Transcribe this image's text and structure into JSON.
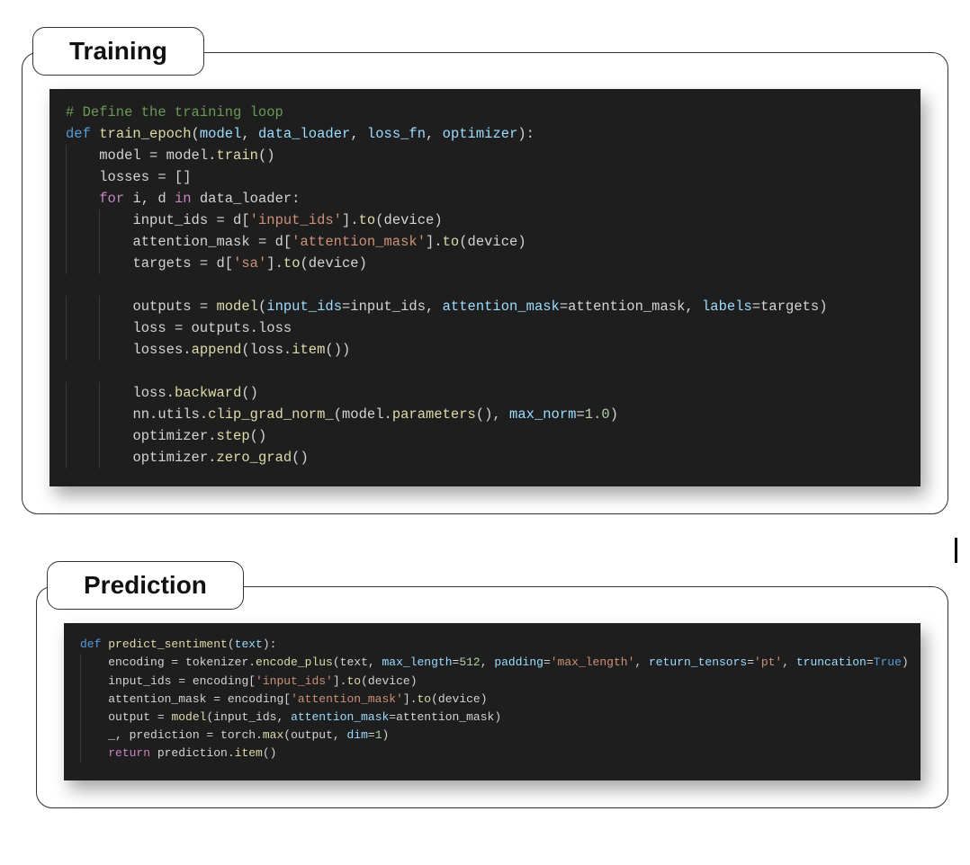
{
  "sections": {
    "training": {
      "title": "Training",
      "code": {
        "tokens": [
          [
            {
              "t": "# Define the training loop",
              "c": "comment"
            }
          ],
          [
            {
              "t": "def ",
              "c": "keyword"
            },
            {
              "t": "train_epoch",
              "c": "func"
            },
            {
              "t": "(",
              "c": "default"
            },
            {
              "t": "model",
              "c": "var"
            },
            {
              "t": ", ",
              "c": "default"
            },
            {
              "t": "data_loader",
              "c": "var"
            },
            {
              "t": ", ",
              "c": "default"
            },
            {
              "t": "loss_fn",
              "c": "var"
            },
            {
              "t": ", ",
              "c": "default"
            },
            {
              "t": "optimizer",
              "c": "var"
            },
            {
              "t": "):",
              "c": "default"
            }
          ],
          [
            {
              "t": "    ",
              "c": "indent1"
            },
            {
              "t": "model = model.",
              "c": "default"
            },
            {
              "t": "train",
              "c": "func"
            },
            {
              "t": "()",
              "c": "default"
            }
          ],
          [
            {
              "t": "    ",
              "c": "indent1"
            },
            {
              "t": "losses = []",
              "c": "default"
            }
          ],
          [
            {
              "t": "    ",
              "c": "indent1"
            },
            {
              "t": "for ",
              "c": "control"
            },
            {
              "t": "i, d ",
              "c": "default"
            },
            {
              "t": "in ",
              "c": "control"
            },
            {
              "t": "data_loader:",
              "c": "default"
            }
          ],
          [
            {
              "t": "        ",
              "c": "indent2"
            },
            {
              "t": "input_ids = d[",
              "c": "default"
            },
            {
              "t": "'input_ids'",
              "c": "string"
            },
            {
              "t": "].",
              "c": "default"
            },
            {
              "t": "to",
              "c": "func"
            },
            {
              "t": "(device)",
              "c": "default"
            }
          ],
          [
            {
              "t": "        ",
              "c": "indent2"
            },
            {
              "t": "attention_mask = d[",
              "c": "default"
            },
            {
              "t": "'attention_mask'",
              "c": "string"
            },
            {
              "t": "].",
              "c": "default"
            },
            {
              "t": "to",
              "c": "func"
            },
            {
              "t": "(device)",
              "c": "default"
            }
          ],
          [
            {
              "t": "        ",
              "c": "indent2"
            },
            {
              "t": "targets = d[",
              "c": "default"
            },
            {
              "t": "'sa'",
              "c": "string"
            },
            {
              "t": "].",
              "c": "default"
            },
            {
              "t": "to",
              "c": "func"
            },
            {
              "t": "(device)",
              "c": "default"
            }
          ],
          [
            {
              "t": "",
              "c": "blank"
            }
          ],
          [
            {
              "t": "        ",
              "c": "indent2"
            },
            {
              "t": "outputs = ",
              "c": "default"
            },
            {
              "t": "model",
              "c": "func"
            },
            {
              "t": "(",
              "c": "default"
            },
            {
              "t": "input_ids",
              "c": "var"
            },
            {
              "t": "=input_ids, ",
              "c": "default"
            },
            {
              "t": "attention_mask",
              "c": "var"
            },
            {
              "t": "=attention_mask, ",
              "c": "default"
            },
            {
              "t": "labels",
              "c": "var"
            },
            {
              "t": "=targets)",
              "c": "default"
            }
          ],
          [
            {
              "t": "        ",
              "c": "indent2"
            },
            {
              "t": "loss = outputs.loss",
              "c": "default"
            }
          ],
          [
            {
              "t": "        ",
              "c": "indent2"
            },
            {
              "t": "losses.",
              "c": "default"
            },
            {
              "t": "append",
              "c": "func"
            },
            {
              "t": "(loss.",
              "c": "default"
            },
            {
              "t": "item",
              "c": "func"
            },
            {
              "t": "())",
              "c": "default"
            }
          ],
          [
            {
              "t": "",
              "c": "blank"
            }
          ],
          [
            {
              "t": "        ",
              "c": "indent2"
            },
            {
              "t": "loss.",
              "c": "default"
            },
            {
              "t": "backward",
              "c": "func"
            },
            {
              "t": "()",
              "c": "default"
            }
          ],
          [
            {
              "t": "        ",
              "c": "indent2"
            },
            {
              "t": "nn.utils.",
              "c": "default"
            },
            {
              "t": "clip_grad_norm_",
              "c": "func"
            },
            {
              "t": "(model.",
              "c": "default"
            },
            {
              "t": "parameters",
              "c": "func"
            },
            {
              "t": "(), ",
              "c": "default"
            },
            {
              "t": "max_norm",
              "c": "var"
            },
            {
              "t": "=",
              "c": "default"
            },
            {
              "t": "1.0",
              "c": "number"
            },
            {
              "t": ")",
              "c": "default"
            }
          ],
          [
            {
              "t": "        ",
              "c": "indent2"
            },
            {
              "t": "optimizer.",
              "c": "default"
            },
            {
              "t": "step",
              "c": "func"
            },
            {
              "t": "()",
              "c": "default"
            }
          ],
          [
            {
              "t": "        ",
              "c": "indent2"
            },
            {
              "t": "optimizer.",
              "c": "default"
            },
            {
              "t": "zero_grad",
              "c": "func"
            },
            {
              "t": "()",
              "c": "default"
            }
          ]
        ]
      }
    },
    "prediction": {
      "title": "Prediction",
      "code": {
        "tokens": [
          [
            {
              "t": "def ",
              "c": "keyword"
            },
            {
              "t": "predict_sentiment",
              "c": "func"
            },
            {
              "t": "(",
              "c": "default"
            },
            {
              "t": "text",
              "c": "var"
            },
            {
              "t": "):",
              "c": "default"
            }
          ],
          [
            {
              "t": "    ",
              "c": "indent1"
            },
            {
              "t": "encoding = tokenizer.",
              "c": "default"
            },
            {
              "t": "encode_plus",
              "c": "func"
            },
            {
              "t": "(text, ",
              "c": "default"
            },
            {
              "t": "max_length",
              "c": "var"
            },
            {
              "t": "=",
              "c": "default"
            },
            {
              "t": "512",
              "c": "number"
            },
            {
              "t": ", ",
              "c": "default"
            },
            {
              "t": "padding",
              "c": "var"
            },
            {
              "t": "=",
              "c": "default"
            },
            {
              "t": "'max_length'",
              "c": "string"
            },
            {
              "t": ", ",
              "c": "default"
            },
            {
              "t": "return_tensors",
              "c": "var"
            },
            {
              "t": "=",
              "c": "default"
            },
            {
              "t": "'pt'",
              "c": "string"
            },
            {
              "t": ", ",
              "c": "default"
            },
            {
              "t": "truncation",
              "c": "var"
            },
            {
              "t": "=",
              "c": "default"
            },
            {
              "t": "True",
              "c": "keyword"
            },
            {
              "t": ")",
              "c": "default"
            }
          ],
          [
            {
              "t": "    ",
              "c": "indent1"
            },
            {
              "t": "input_ids = encoding[",
              "c": "default"
            },
            {
              "t": "'input_ids'",
              "c": "string"
            },
            {
              "t": "].",
              "c": "default"
            },
            {
              "t": "to",
              "c": "func"
            },
            {
              "t": "(device)",
              "c": "default"
            }
          ],
          [
            {
              "t": "    ",
              "c": "indent1"
            },
            {
              "t": "attention_mask = encoding[",
              "c": "default"
            },
            {
              "t": "'attention_mask'",
              "c": "string"
            },
            {
              "t": "].",
              "c": "default"
            },
            {
              "t": "to",
              "c": "func"
            },
            {
              "t": "(device)",
              "c": "default"
            }
          ],
          [
            {
              "t": "    ",
              "c": "indent1"
            },
            {
              "t": "output = ",
              "c": "default"
            },
            {
              "t": "model",
              "c": "func"
            },
            {
              "t": "(input_ids, ",
              "c": "default"
            },
            {
              "t": "attention_mask",
              "c": "var"
            },
            {
              "t": "=attention_mask)",
              "c": "default"
            }
          ],
          [
            {
              "t": "    ",
              "c": "indent1"
            },
            {
              "t": "_, prediction = torch.",
              "c": "default"
            },
            {
              "t": "max",
              "c": "func"
            },
            {
              "t": "(output, ",
              "c": "default"
            },
            {
              "t": "dim",
              "c": "var"
            },
            {
              "t": "=",
              "c": "default"
            },
            {
              "t": "1",
              "c": "number"
            },
            {
              "t": ")",
              "c": "default"
            }
          ],
          [
            {
              "t": "    ",
              "c": "indent1"
            },
            {
              "t": "return ",
              "c": "control"
            },
            {
              "t": "prediction.",
              "c": "default"
            },
            {
              "t": "item",
              "c": "func"
            },
            {
              "t": "()",
              "c": "default"
            }
          ]
        ]
      }
    }
  }
}
